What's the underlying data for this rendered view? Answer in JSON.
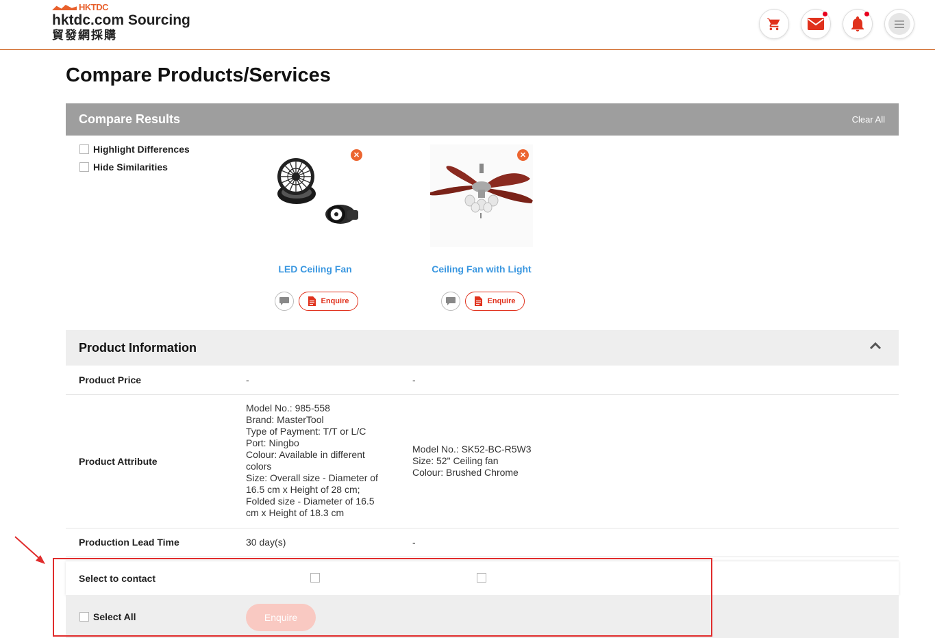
{
  "header": {
    "logo_brand": "HKTDC",
    "logo_title": "hktdc.com Sourcing",
    "logo_chinese": "貿發網採購",
    "icons": [
      "cart-icon",
      "mail-icon",
      "bell-icon",
      "menu-icon"
    ],
    "accent_color": "#e8602c"
  },
  "page": {
    "title": "Compare Products/Services"
  },
  "results": {
    "title": "Compare Results",
    "clear_all": "Clear All",
    "options": [
      "Highlight Differences",
      "Hide Similarities"
    ]
  },
  "products": [
    {
      "name": "LED Ceiling Fan",
      "enquire": "Enquire"
    },
    {
      "name": "Ceiling Fan with Light",
      "enquire": "Enquire"
    }
  ],
  "product_info": {
    "title": "Product Information",
    "rows": [
      {
        "label": "Product Price",
        "values": [
          "-",
          "-"
        ]
      },
      {
        "label": "Product Attribute",
        "values": [
          "Model No.: 985-558\nBrand: MasterTool\nType of Payment: T/T or L/C\nPort: Ningbo\nColour: Available in different\ncolors\nSize: Overall size - Diameter of\n16.5 cm x Height of 28 cm;\nFolded size - Diameter of 16.5\ncm x Height of 18.3 cm",
          "Model No.: SK52-BC-R5W3\nSize: 52\" Ceiling fan\nColour: Brushed Chrome"
        ]
      },
      {
        "label": "Production Lead Time",
        "values": [
          "30 day(s)",
          "-"
        ]
      }
    ]
  },
  "contact": {
    "label": "Select to contact",
    "select_all": "Select All",
    "enquire": "Enquire"
  }
}
